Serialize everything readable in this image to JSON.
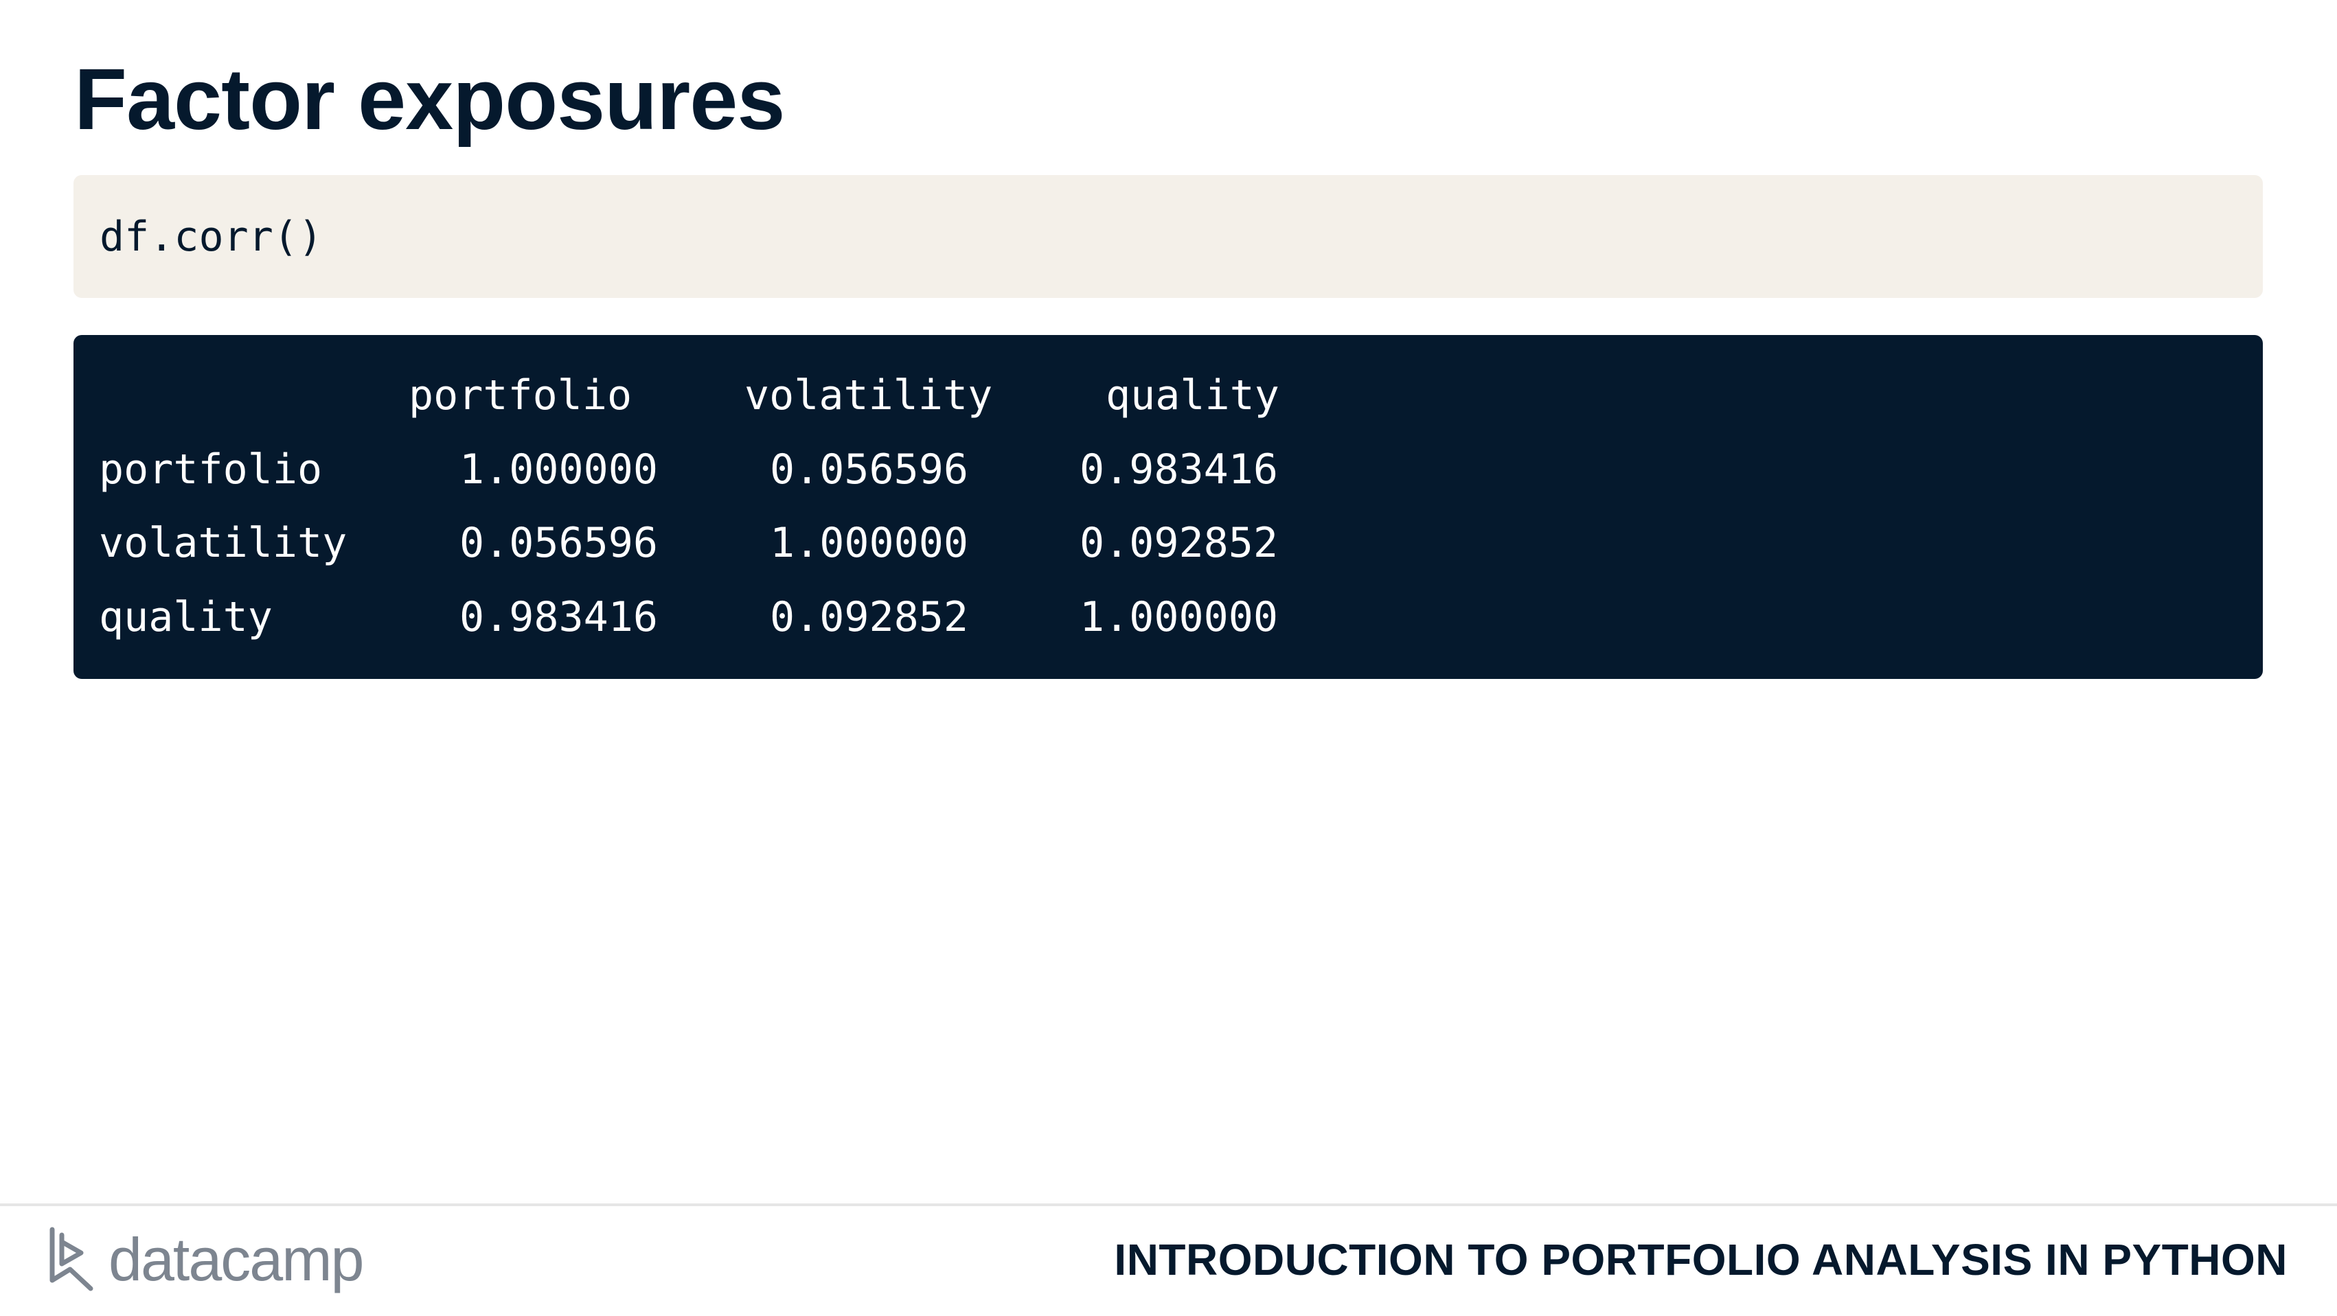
{
  "slide": {
    "title": "Factor exposures"
  },
  "code_input": {
    "code": "df.corr()"
  },
  "code_output": {
    "columns": [
      "portfolio",
      "volatility",
      "quality"
    ],
    "rows": [
      {
        "label": "portfolio",
        "values": [
          "1.000000",
          "0.056596",
          "0.983416"
        ]
      },
      {
        "label": "volatility",
        "values": [
          "0.056596",
          "1.000000",
          "0.092852"
        ]
      },
      {
        "label": "quality",
        "values": [
          "0.983416",
          "0.092852",
          "1.000000"
        ]
      }
    ]
  },
  "footer": {
    "brand": "datacamp",
    "course_title": "INTRODUCTION TO PORTFOLIO ANALYSIS IN PYTHON"
  },
  "colors": {
    "navy": "#05192d",
    "cream": "#f4f0e9",
    "logo_gray": "#7d8590"
  },
  "icons": {
    "logo": "datacamp-logo-icon"
  }
}
